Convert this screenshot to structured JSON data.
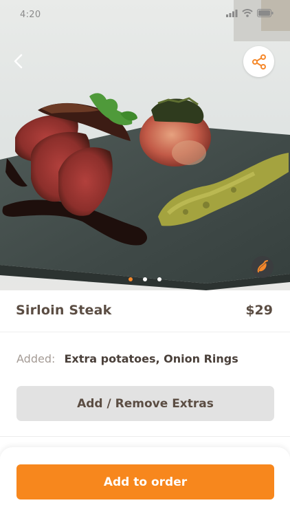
{
  "status_bar": {
    "time": "4:20"
  },
  "hero": {
    "image_description": "grilled sirloin steak slices with sauce, roasted potato and pea puree on a slate board",
    "back_icon": "chevron-left-icon",
    "share_icon": "share-icon",
    "spicy_icon": "chili-pepper-icon",
    "carousel": {
      "count": 3,
      "active_index": 0
    }
  },
  "product": {
    "name": "Sirloin Steak",
    "price": "$29"
  },
  "added": {
    "label": "Added:",
    "value": "Extra potatoes, Onion Rings"
  },
  "extras_button": {
    "label": "Add / Remove Extras"
  },
  "order_button": {
    "label": "Add to order"
  },
  "colors": {
    "accent": "#f7871d",
    "text_dark": "#5b4d43",
    "text_muted": "#a49b95",
    "button_gray": "#e2e2e2"
  }
}
